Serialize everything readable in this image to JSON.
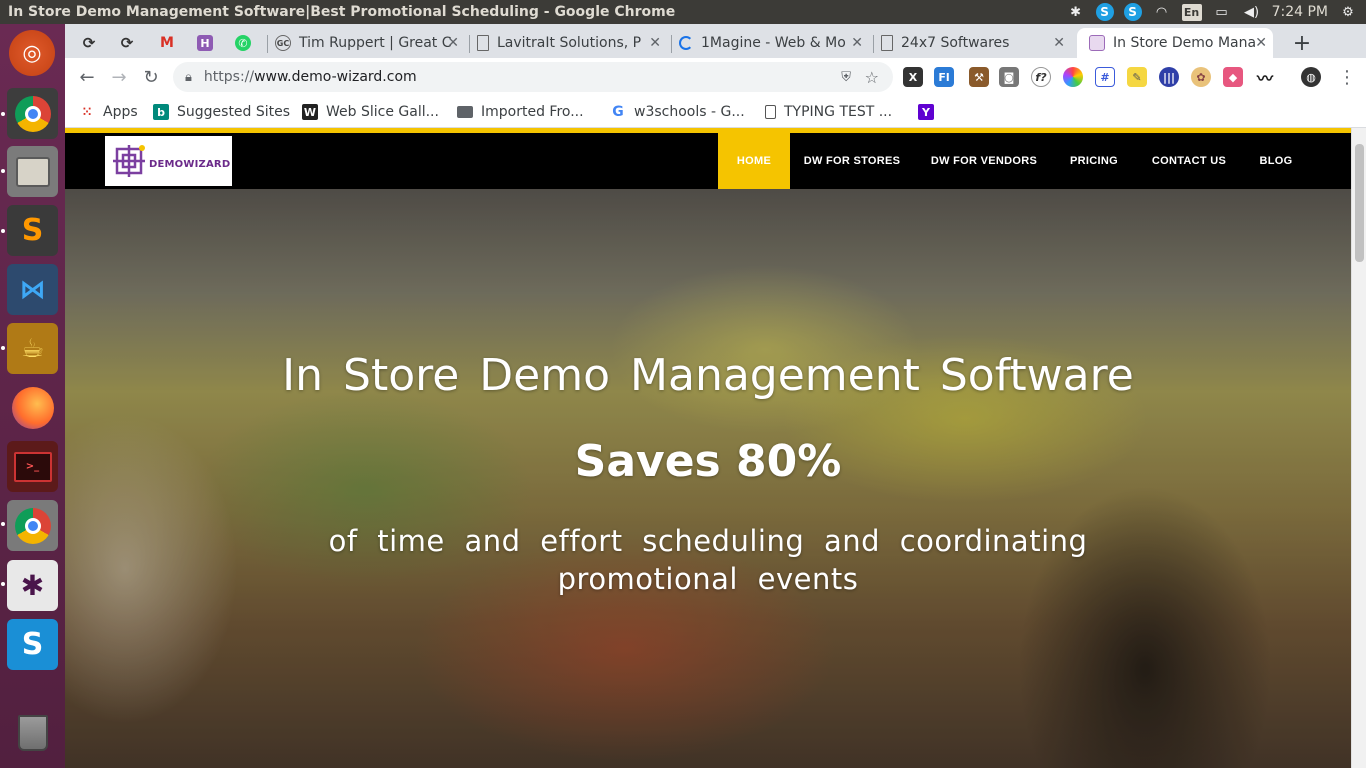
{
  "os": {
    "window_title": "In Store Demo Management Software|Best Promotional Scheduling - Google Chrome",
    "keyboard_layout": "En",
    "clock": "7:24 PM"
  },
  "launcher": {
    "items": [
      "ubuntu",
      "chrome",
      "files",
      "sublime-text",
      "vscode",
      "teapot-app",
      "firefox",
      "terminal",
      "chrome",
      "slack",
      "skype",
      "trash"
    ]
  },
  "tabs": [
    {
      "title": "",
      "favicon": "sync-error"
    },
    {
      "title": "",
      "favicon": "sync-error"
    },
    {
      "title": "",
      "favicon": "gmail"
    },
    {
      "title": "",
      "favicon": "h-app"
    },
    {
      "title": "",
      "favicon": "whatsapp"
    },
    {
      "title": "Tim Ruppert | Great C",
      "favicon": "circle-logo"
    },
    {
      "title": "LavitraIt Solutions, P",
      "favicon": "page"
    },
    {
      "title": "1Magine - Web & Mo",
      "favicon": "loading"
    },
    {
      "title": "24x7 Softwares",
      "favicon": "page"
    },
    {
      "title": "In Store Demo Mana",
      "favicon": "demowizard",
      "active": true
    }
  ],
  "address_bar": {
    "scheme": "https://",
    "host": "www.demo-wizard.com"
  },
  "bookmarks": [
    {
      "label": "Apps",
      "icon": "apps-grid-icon"
    },
    {
      "label": "Suggested Sites",
      "icon": "bing-icon"
    },
    {
      "label": "Web Slice Gall...",
      "icon": "webslice-icon"
    },
    {
      "label": "Imported Fro...",
      "icon": "folder-icon"
    },
    {
      "label": "w3schools - G...",
      "icon": "google-icon"
    },
    {
      "label": "TYPING TEST ...",
      "icon": "page-icon"
    },
    {
      "label": "",
      "icon": "yahoo-icon"
    }
  ],
  "site": {
    "logo_text": "DEMOWIZARD",
    "nav": [
      {
        "label": "HOME",
        "active": true
      },
      {
        "label": "DW FOR STORES"
      },
      {
        "label": "DW FOR VENDORS"
      },
      {
        "label": "PRICING"
      },
      {
        "label": "CONTACT US"
      },
      {
        "label": "BLOG"
      }
    ],
    "hero": {
      "heading": "In Store Demo Management Software",
      "subheading": "Saves 80%",
      "tagline": "of time and effort scheduling and coordinating promotional events"
    }
  },
  "colors": {
    "accent_yellow": "#f5c400",
    "launcher_purple": "#6a2a53",
    "nav_black": "#000000"
  }
}
